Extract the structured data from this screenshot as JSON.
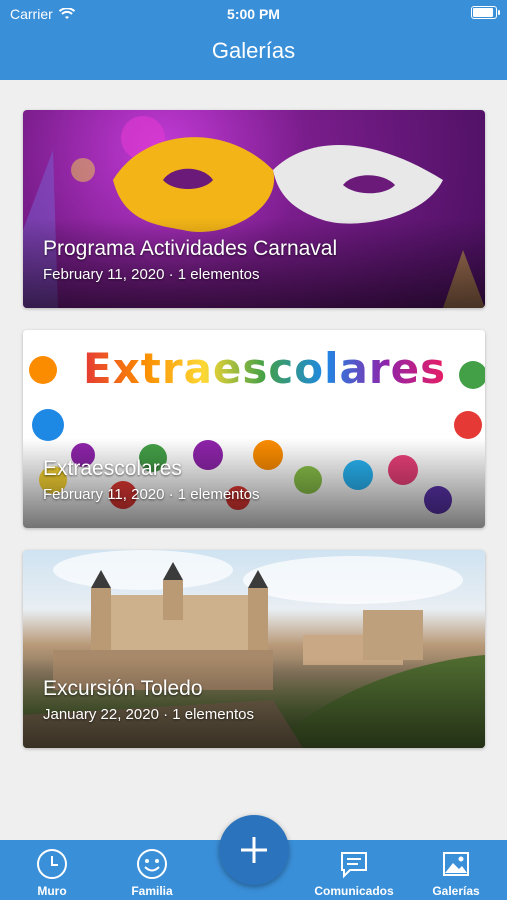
{
  "status_bar": {
    "carrier": "Carrier",
    "time": "5:00 PM"
  },
  "header": {
    "title": "Galerías"
  },
  "galleries": [
    {
      "title": "Programa Actividades Carnaval",
      "meta": "February 11, 2020 · 1 elementos",
      "image": "carnival-masks"
    },
    {
      "title": "Extraescolares",
      "meta": "February 11, 2020 · 1 elementos",
      "image": "colorful-hands",
      "image_text": "Extraescolares"
    },
    {
      "title": "Excursión Toledo",
      "meta": "January 22, 2020 · 1 elementos",
      "image": "toledo-alcazar"
    }
  ],
  "tabbar": {
    "tabs": [
      {
        "label": "Muro",
        "icon": "clock-icon"
      },
      {
        "label": "Familia",
        "icon": "smiley-icon"
      },
      {
        "label": "Comunicados",
        "icon": "message-icon"
      },
      {
        "label": "Galerías",
        "icon": "image-icon"
      }
    ],
    "fab_icon": "plus-icon"
  },
  "colors": {
    "primary": "#3a8fd9",
    "fab": "#2b74bd",
    "background": "#efefef"
  }
}
